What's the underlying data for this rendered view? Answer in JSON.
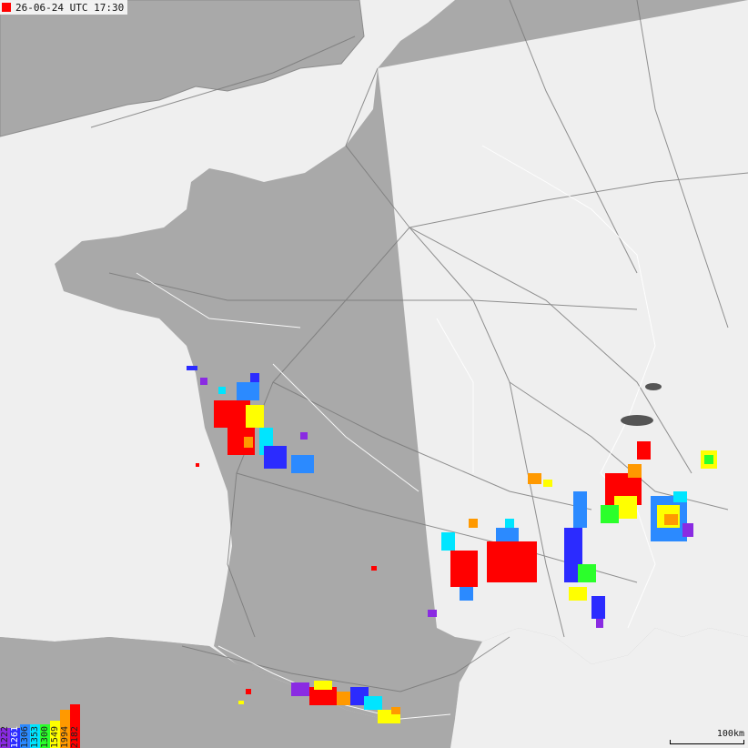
{
  "header": {
    "timestamp": "26-06-24 UTC 17:30",
    "marker_color": "#ff0000"
  },
  "legend": {
    "items": [
      {
        "label": "1222",
        "color": "#8a2be2"
      },
      {
        "label": "1261",
        "color": "#2b2bff"
      },
      {
        "label": "1306",
        "color": "#2b8aff"
      },
      {
        "label": "1353",
        "color": "#00e5ff"
      },
      {
        "label": "1300",
        "color": "#2bff2b"
      },
      {
        "label": "1549",
        "color": "#ffff00"
      },
      {
        "label": "1994",
        "color": "#ff9900"
      },
      {
        "label": "2182",
        "color": "#ff0000"
      }
    ]
  },
  "scale": {
    "label": "100km"
  },
  "colors": {
    "sea": "#efefef",
    "land": "#a9a9a9",
    "roads": "#7a7a7a",
    "borders": "#ffffff"
  }
}
